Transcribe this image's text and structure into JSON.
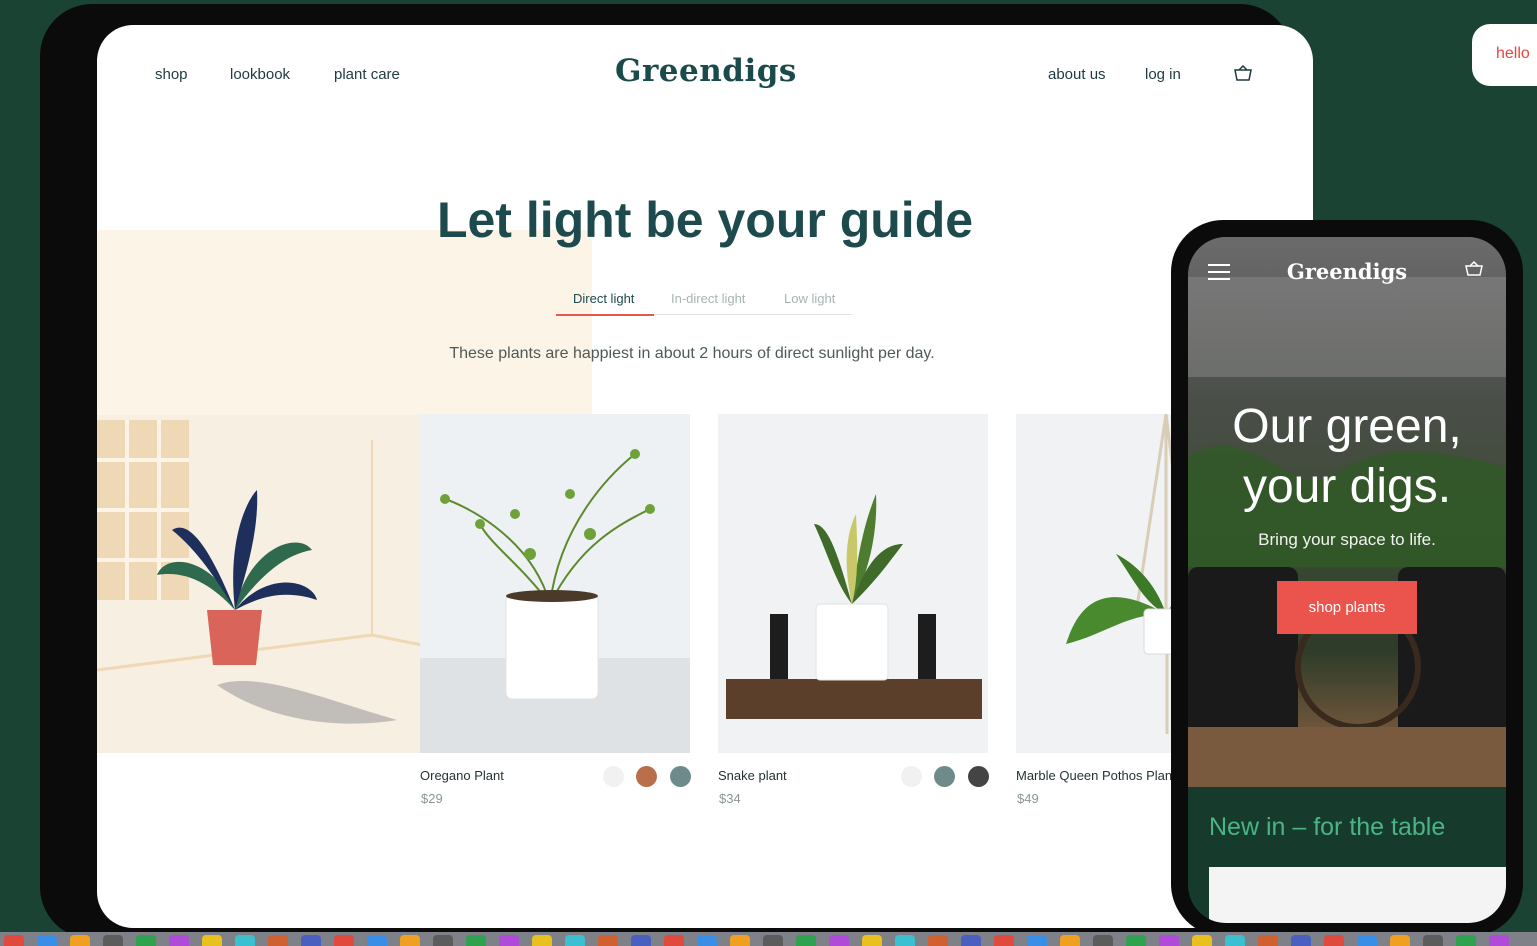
{
  "tablet": {
    "nav": {
      "left_links": [
        "shop",
        "lookbook",
        "plant care"
      ],
      "logo": "Greendigs",
      "right_links": [
        "about us",
        "log in"
      ],
      "cart_icon": "basket-icon"
    },
    "headline": "Let light be your guide",
    "tabs": [
      {
        "label": "Direct light",
        "active": true
      },
      {
        "label": "In-direct light",
        "active": false
      },
      {
        "label": "Low light",
        "active": false
      }
    ],
    "subtitle": "These plants are happiest in about 2 hours of direct sunlight per day.",
    "products": [
      {
        "name": "Oregano Plant",
        "price": "$29",
        "swatches": [
          "#f1f1f1",
          "#b9704a",
          "#6f8a8a"
        ]
      },
      {
        "name": "Snake plant",
        "price": "$34",
        "swatches": [
          "#f1f1f1",
          "#6f8a8a",
          "#444444"
        ]
      },
      {
        "name": "Marble Queen Pothos Plant",
        "price": "$49",
        "swatches": [
          "#f1f1f1"
        ]
      }
    ]
  },
  "phone": {
    "logo": "Greendigs",
    "menu_icon": "hamburger-icon",
    "cart_icon": "basket-icon",
    "hero_heading_line1": "Our green,",
    "hero_heading_line2": "your digs.",
    "hero_sub": "Bring your space to life.",
    "cta": "shop plants",
    "section_title": "New in – for the table"
  },
  "hello_badge": "hello",
  "colors": {
    "background": "#1b4334",
    "brand_dark": "#1d4a4c",
    "accent": "#e7574f",
    "section_green": "#4bb485"
  }
}
